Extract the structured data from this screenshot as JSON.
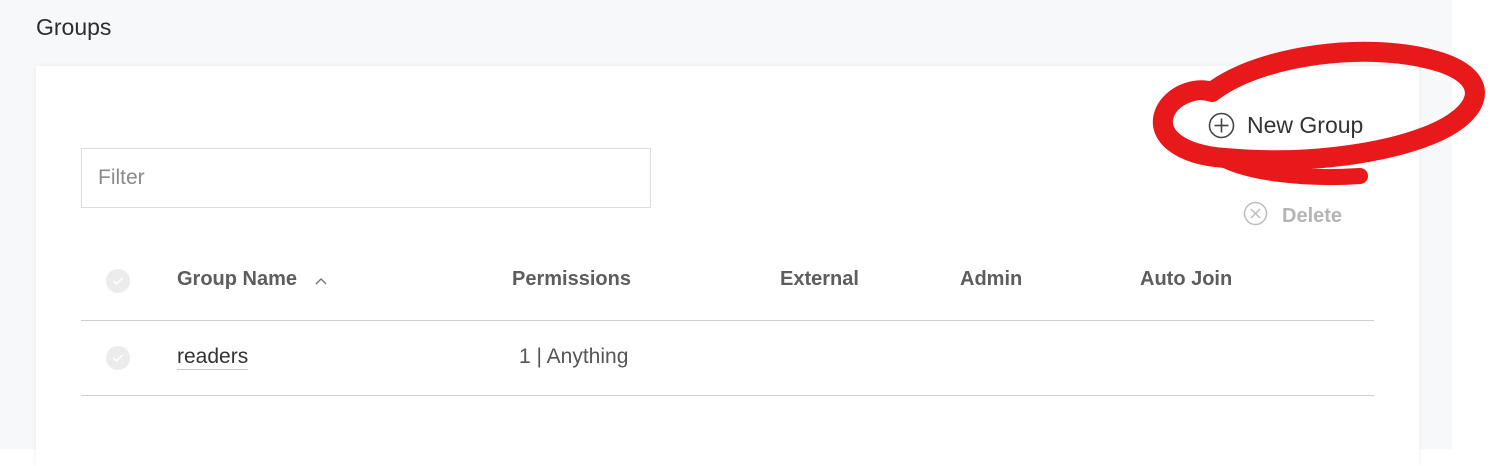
{
  "page": {
    "title": "Groups"
  },
  "toolbar": {
    "new_group_label": "New Group",
    "new_group_icon": "plus-circle-icon",
    "delete_label": "Delete",
    "delete_icon": "x-circle-icon"
  },
  "filter": {
    "placeholder": "Filter",
    "value": ""
  },
  "table": {
    "columns": [
      {
        "label": "Group Name",
        "sort": "ascending"
      },
      {
        "label": "Permissions"
      },
      {
        "label": "External"
      },
      {
        "label": "Admin"
      },
      {
        "label": "Auto Join"
      }
    ],
    "rows": [
      {
        "group_name": "readers",
        "permissions": "1 | Anything",
        "external": "",
        "admin": "",
        "auto_join": ""
      }
    ]
  },
  "colors": {
    "annotation": "#e8191b",
    "disabled_text": "#b5b5b5",
    "page_background": "#f7f8fa"
  }
}
